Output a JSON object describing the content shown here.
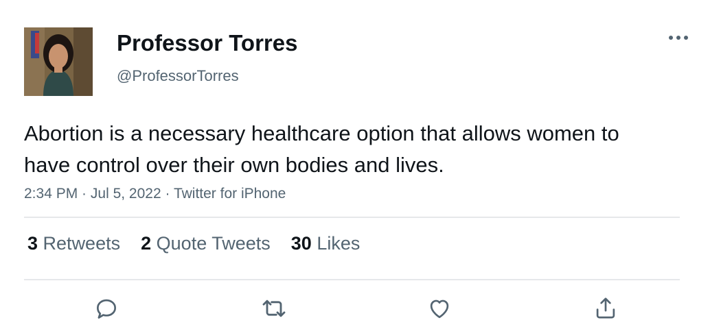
{
  "tweet": {
    "display_name": "Professor Torres",
    "handle": "@ProfessorTorres",
    "text": "Abortion is a necessary healthcare option that allows women to have control over their own bodies and lives.",
    "time": "2:34 PM",
    "date": "Jul 5, 2022",
    "source": "Twitter for iPhone",
    "separator": " · "
  },
  "stats": {
    "retweets_count": "3",
    "retweets_label": "Retweets",
    "quotes_count": "2",
    "quotes_label": "Quote Tweets",
    "likes_count": "30",
    "likes_label": "Likes"
  },
  "icons": {
    "more": "more-horizontal-icon",
    "reply": "reply-icon",
    "retweet": "retweet-icon",
    "like": "heart-icon",
    "share": "share-icon"
  },
  "colors": {
    "text_primary": "#0f1419",
    "text_secondary": "#536471",
    "divider": "#e6e8ea"
  }
}
